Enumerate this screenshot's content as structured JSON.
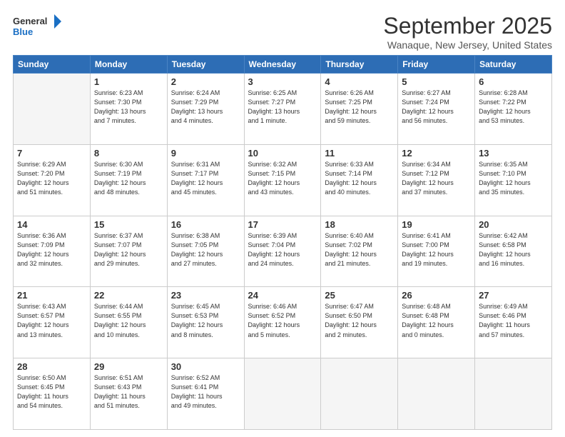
{
  "logo": {
    "line1": "General",
    "line2": "Blue"
  },
  "header": {
    "month": "September 2025",
    "location": "Wanaque, New Jersey, United States"
  },
  "days_of_week": [
    "Sunday",
    "Monday",
    "Tuesday",
    "Wednesday",
    "Thursday",
    "Friday",
    "Saturday"
  ],
  "weeks": [
    [
      {
        "day": "",
        "info": ""
      },
      {
        "day": "1",
        "info": "Sunrise: 6:23 AM\nSunset: 7:30 PM\nDaylight: 13 hours\nand 7 minutes."
      },
      {
        "day": "2",
        "info": "Sunrise: 6:24 AM\nSunset: 7:29 PM\nDaylight: 13 hours\nand 4 minutes."
      },
      {
        "day": "3",
        "info": "Sunrise: 6:25 AM\nSunset: 7:27 PM\nDaylight: 13 hours\nand 1 minute."
      },
      {
        "day": "4",
        "info": "Sunrise: 6:26 AM\nSunset: 7:25 PM\nDaylight: 12 hours\nand 59 minutes."
      },
      {
        "day": "5",
        "info": "Sunrise: 6:27 AM\nSunset: 7:24 PM\nDaylight: 12 hours\nand 56 minutes."
      },
      {
        "day": "6",
        "info": "Sunrise: 6:28 AM\nSunset: 7:22 PM\nDaylight: 12 hours\nand 53 minutes."
      }
    ],
    [
      {
        "day": "7",
        "info": "Sunrise: 6:29 AM\nSunset: 7:20 PM\nDaylight: 12 hours\nand 51 minutes."
      },
      {
        "day": "8",
        "info": "Sunrise: 6:30 AM\nSunset: 7:19 PM\nDaylight: 12 hours\nand 48 minutes."
      },
      {
        "day": "9",
        "info": "Sunrise: 6:31 AM\nSunset: 7:17 PM\nDaylight: 12 hours\nand 45 minutes."
      },
      {
        "day": "10",
        "info": "Sunrise: 6:32 AM\nSunset: 7:15 PM\nDaylight: 12 hours\nand 43 minutes."
      },
      {
        "day": "11",
        "info": "Sunrise: 6:33 AM\nSunset: 7:14 PM\nDaylight: 12 hours\nand 40 minutes."
      },
      {
        "day": "12",
        "info": "Sunrise: 6:34 AM\nSunset: 7:12 PM\nDaylight: 12 hours\nand 37 minutes."
      },
      {
        "day": "13",
        "info": "Sunrise: 6:35 AM\nSunset: 7:10 PM\nDaylight: 12 hours\nand 35 minutes."
      }
    ],
    [
      {
        "day": "14",
        "info": "Sunrise: 6:36 AM\nSunset: 7:09 PM\nDaylight: 12 hours\nand 32 minutes."
      },
      {
        "day": "15",
        "info": "Sunrise: 6:37 AM\nSunset: 7:07 PM\nDaylight: 12 hours\nand 29 minutes."
      },
      {
        "day": "16",
        "info": "Sunrise: 6:38 AM\nSunset: 7:05 PM\nDaylight: 12 hours\nand 27 minutes."
      },
      {
        "day": "17",
        "info": "Sunrise: 6:39 AM\nSunset: 7:04 PM\nDaylight: 12 hours\nand 24 minutes."
      },
      {
        "day": "18",
        "info": "Sunrise: 6:40 AM\nSunset: 7:02 PM\nDaylight: 12 hours\nand 21 minutes."
      },
      {
        "day": "19",
        "info": "Sunrise: 6:41 AM\nSunset: 7:00 PM\nDaylight: 12 hours\nand 19 minutes."
      },
      {
        "day": "20",
        "info": "Sunrise: 6:42 AM\nSunset: 6:58 PM\nDaylight: 12 hours\nand 16 minutes."
      }
    ],
    [
      {
        "day": "21",
        "info": "Sunrise: 6:43 AM\nSunset: 6:57 PM\nDaylight: 12 hours\nand 13 minutes."
      },
      {
        "day": "22",
        "info": "Sunrise: 6:44 AM\nSunset: 6:55 PM\nDaylight: 12 hours\nand 10 minutes."
      },
      {
        "day": "23",
        "info": "Sunrise: 6:45 AM\nSunset: 6:53 PM\nDaylight: 12 hours\nand 8 minutes."
      },
      {
        "day": "24",
        "info": "Sunrise: 6:46 AM\nSunset: 6:52 PM\nDaylight: 12 hours\nand 5 minutes."
      },
      {
        "day": "25",
        "info": "Sunrise: 6:47 AM\nSunset: 6:50 PM\nDaylight: 12 hours\nand 2 minutes."
      },
      {
        "day": "26",
        "info": "Sunrise: 6:48 AM\nSunset: 6:48 PM\nDaylight: 12 hours\nand 0 minutes."
      },
      {
        "day": "27",
        "info": "Sunrise: 6:49 AM\nSunset: 6:46 PM\nDaylight: 11 hours\nand 57 minutes."
      }
    ],
    [
      {
        "day": "28",
        "info": "Sunrise: 6:50 AM\nSunset: 6:45 PM\nDaylight: 11 hours\nand 54 minutes."
      },
      {
        "day": "29",
        "info": "Sunrise: 6:51 AM\nSunset: 6:43 PM\nDaylight: 11 hours\nand 51 minutes."
      },
      {
        "day": "30",
        "info": "Sunrise: 6:52 AM\nSunset: 6:41 PM\nDaylight: 11 hours\nand 49 minutes."
      },
      {
        "day": "",
        "info": ""
      },
      {
        "day": "",
        "info": ""
      },
      {
        "day": "",
        "info": ""
      },
      {
        "day": "",
        "info": ""
      }
    ]
  ]
}
